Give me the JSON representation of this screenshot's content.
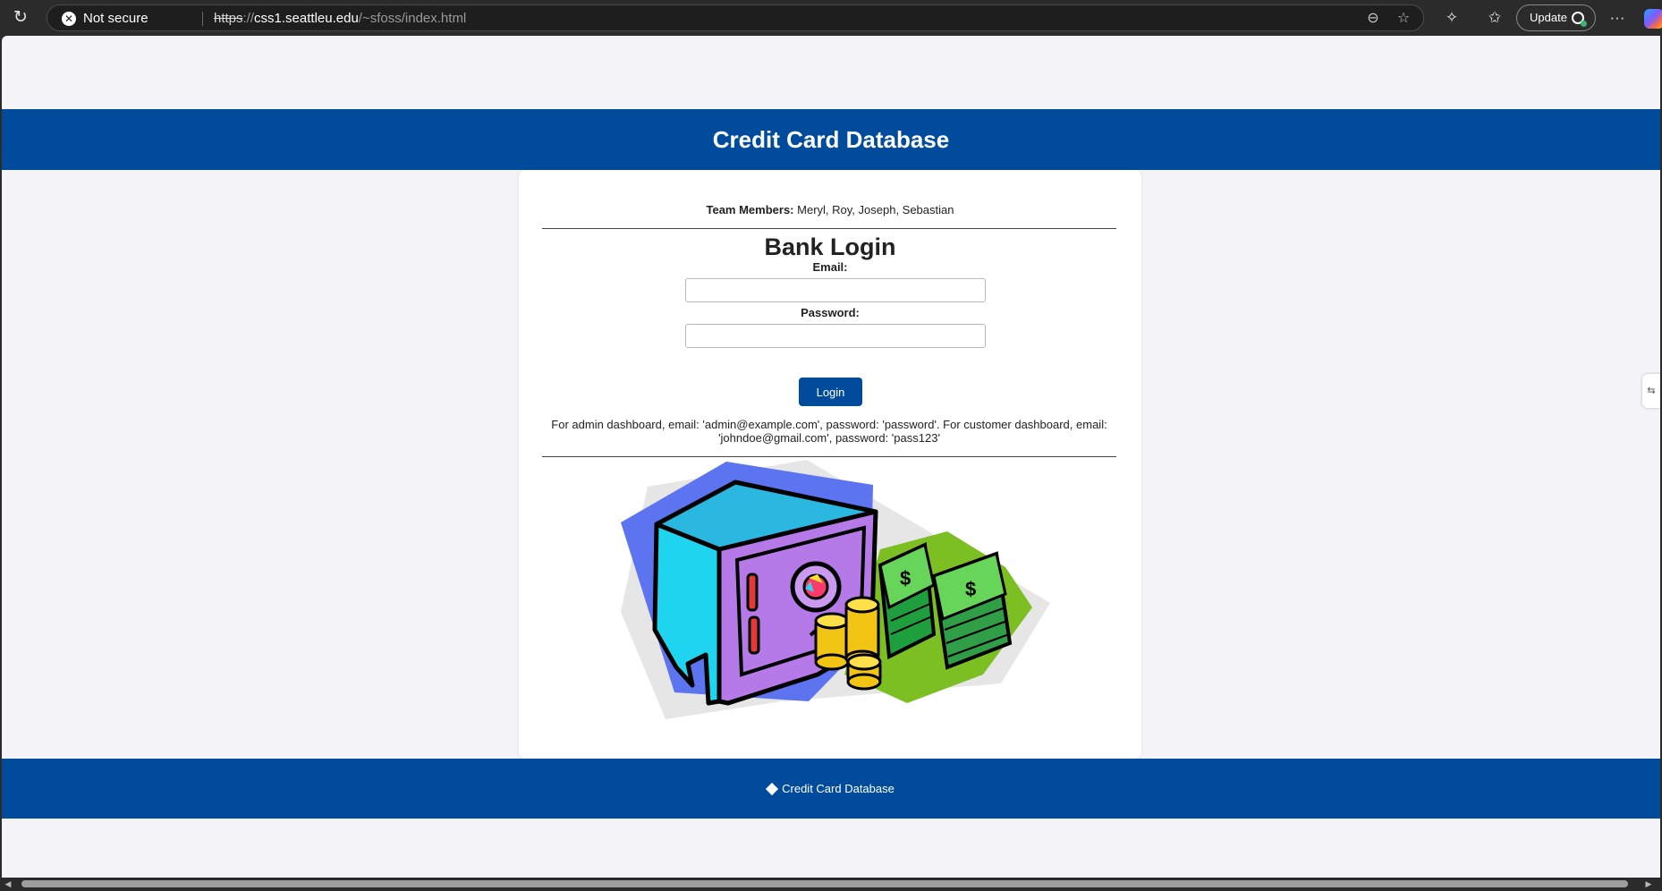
{
  "browser": {
    "security_label": "Not secure",
    "url_scheme": "https",
    "url_host": "css1.seattleu.edu",
    "url_path": "/~sfoss/index.html",
    "update_label": "Update",
    "icons": [
      "reload-icon",
      "not-secure-icon",
      "zoom-out-icon",
      "favorite-star-icon",
      "extensions-icon",
      "favorites-icon",
      "update-heart-icon",
      "more-menu-icon",
      "copilot-icon"
    ]
  },
  "page": {
    "header_title": "Credit Card Database",
    "team_label": "Team Members:",
    "team_names": "Meryl, Roy, Joseph, Sebastian",
    "login_title": "Bank Login",
    "email_label": "Email:",
    "email_value": "",
    "password_label": "Password:",
    "password_value": "",
    "login_button": "Login",
    "hint_text": "For admin dashboard, email: 'admin@example.com', password: 'password'. For customer dashboard, email: 'johndoe@gmail.com', password: 'pass123'",
    "footer_text": "Credit Card Database",
    "illustration": "bank-safe-and-money-clipart"
  },
  "colors": {
    "brand_blue": "#004b9c",
    "page_bg": "#f4f4f8",
    "chrome_bg": "#2b2b2b"
  }
}
